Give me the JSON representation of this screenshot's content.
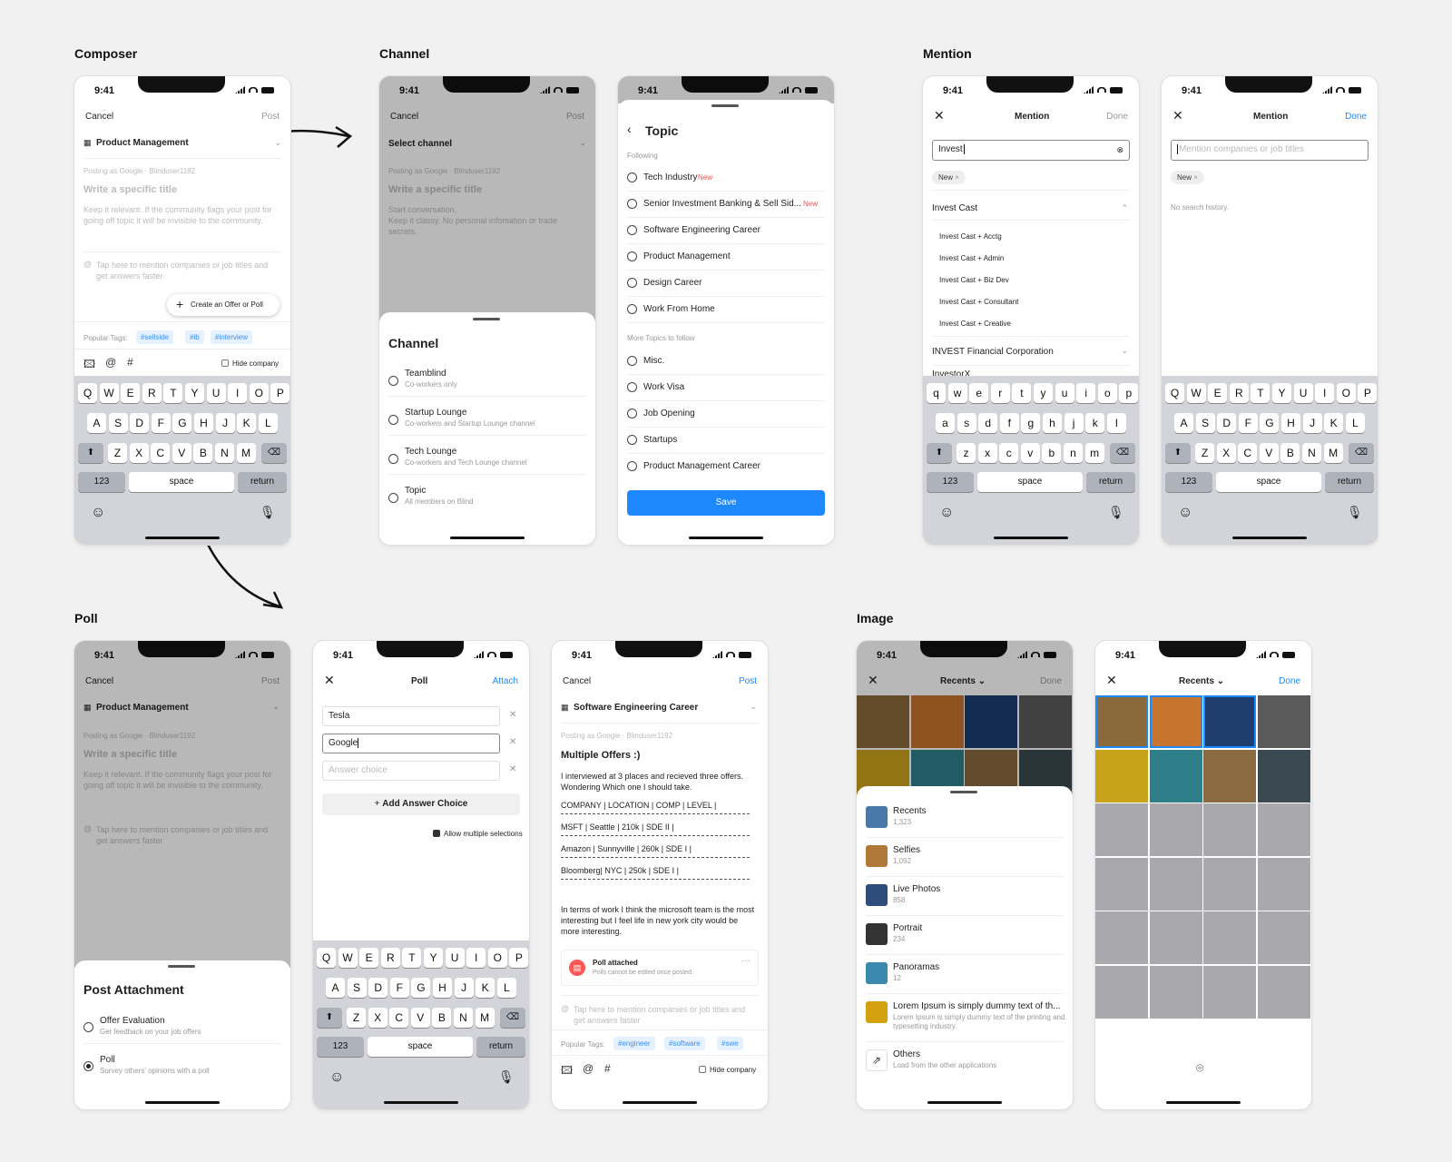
{
  "sections": {
    "composer": "Composer",
    "channel": "Channel",
    "mention": "Mention",
    "poll": "Poll",
    "image": "Image"
  },
  "status_time": "9:41",
  "keyboard": {
    "upper": [
      [
        "Q",
        "W",
        "E",
        "R",
        "T",
        "Y",
        "U",
        "I",
        "O",
        "P"
      ],
      [
        "A",
        "S",
        "D",
        "F",
        "G",
        "H",
        "J",
        "K",
        "L"
      ],
      [
        "Z",
        "X",
        "C",
        "V",
        "B",
        "N",
        "M"
      ]
    ],
    "lower": [
      [
        "q",
        "w",
        "e",
        "r",
        "t",
        "y",
        "u",
        "i",
        "o",
        "p"
      ],
      [
        "a",
        "s",
        "d",
        "f",
        "g",
        "h",
        "j",
        "k",
        "l"
      ],
      [
        "z",
        "x",
        "c",
        "v",
        "b",
        "n",
        "m"
      ]
    ],
    "num": "123",
    "space": "space",
    "return": "return"
  },
  "composer": {
    "cancel": "Cancel",
    "post": "Post",
    "channel": "Product Management",
    "posting_as": "Posting as Google · Blinduser1192",
    "title_ph": "Write a specific title",
    "body_ph": "Keep it relevant. If the community flags your post for going off topic it will be invisible to the community.",
    "mention_ph": "Tap here to mention companies or job titles and get answers faster",
    "offer_btn": "Create an Offer or Poll",
    "popular": "Popular Tags:",
    "tags": [
      "#sellside",
      "#ib",
      "#interview"
    ],
    "hide_company": "Hide company"
  },
  "channel1": {
    "cancel": "Cancel",
    "post": "Post",
    "select": "Select channel",
    "posting_as": "Posting as Google · Blinduser1192",
    "title_ph": "Write a specific title",
    "body_ph": "Start conversation.\nKeep it classy. No personal infomation or trade secrets.",
    "sheet_title": "Channel",
    "items": [
      {
        "name": "Teamblind",
        "sub": "Co-workers only"
      },
      {
        "name": "Startup Lounge",
        "sub": "Co-workers and Startup Lounge channel"
      },
      {
        "name": "Tech Lounge",
        "sub": "Co-workers and Tech Lounge channel"
      },
      {
        "name": "Topic",
        "sub": "All members on Blind"
      }
    ]
  },
  "topic": {
    "title": "Topic",
    "following": "Following",
    "follow_items": [
      {
        "name": "Tech Industry",
        "badge": "New"
      },
      {
        "name": "Senior Investment Banking & Sell Sid...",
        "badge": "New"
      },
      {
        "name": "Software Engineering Career",
        "badge": ""
      },
      {
        "name": "Product Management",
        "badge": ""
      },
      {
        "name": "Design Career",
        "badge": ""
      },
      {
        "name": "Work From Home",
        "badge": ""
      }
    ],
    "more": "More Topics to follow",
    "more_items": [
      "Misc.",
      "Work Visa",
      "Job Opening",
      "Startups",
      "Product Management Career"
    ],
    "save": "Save"
  },
  "mention1": {
    "title": "Mention",
    "done": "Done",
    "query": "Invest",
    "chip": "New",
    "group": "Invest Cast",
    "items": [
      "Invest Cast + Acctg",
      "Invest Cast + Admin",
      "Invest Cast + Biz Dev",
      "Invest Cast + Consultant",
      "Invest Cast + Creative"
    ],
    "group2": "INVEST Financial Corporation",
    "group3": "InvestorX"
  },
  "mention2": {
    "title": "Mention",
    "done": "Done",
    "placeholder": "Mention companies or job titles",
    "chip": "New",
    "empty": "No search history."
  },
  "poll_attach": {
    "cancel": "Cancel",
    "post": "Post",
    "channel": "Product Management",
    "posting_as": "Posting as Google · Blinduser1192",
    "title_ph": "Write a specific title",
    "body_ph": "Keep it relevant. If the community flags your post for going off topic it will be invisible to the community.",
    "mention_ph": "Tap here to mention companies or job titles and get answers faster",
    "sheet_title": "Post Attachment",
    "items": [
      {
        "name": "Offer Evaluation",
        "sub": "Get feedback on your job offers"
      },
      {
        "name": "Poll",
        "sub": "Survey others' opinions with a poll"
      }
    ]
  },
  "poll_edit": {
    "title": "Poll",
    "attach": "Attach",
    "answers": [
      "Tesla",
      "Google"
    ],
    "answer_ph": "Answer choice",
    "add": "Add Answer Choice",
    "multiple": "Allow multiple selections"
  },
  "poll_post": {
    "cancel": "Cancel",
    "post": "Post",
    "channel": "Software Engineering Career",
    "posting_as": "Posting as Google · Blinduser1192",
    "title": "Multiple Offers :)",
    "intro": "I interviewed at 3 places and recieved three offers. Wondering Which one I should take.",
    "lines": [
      "COMPANY | LOCATION | COMP | LEVEL |",
      "MSFT | Seattle | 210k | SDE II |",
      "Amazon | Sunnyville | 260k | SDE I |",
      "Bloomberg| NYC | 250k | SDE I |"
    ],
    "outro": "In terms of work I think the microsoft team is the most interesting but I feel life in new york city would be more interesting.",
    "poll_title": "Poll attached",
    "poll_sub": "Polls cannot be edited once posted.",
    "mention_ph": "Tap here to mention companies or job titles and get answers faster",
    "popular": "Popular Tags:",
    "tags": [
      "#engineer",
      "#software",
      "#swe"
    ],
    "hide_company": "Hide company"
  },
  "image1": {
    "recents": "Recents",
    "done": "Done",
    "albums": [
      {
        "name": "Recents",
        "count": "1,323"
      },
      {
        "name": "Selfies",
        "count": "1,092"
      },
      {
        "name": "Live Photos",
        "count": "858"
      },
      {
        "name": "Portrait",
        "count": "234"
      },
      {
        "name": "Panoramas",
        "count": "12"
      },
      {
        "name": "Lorem Ipsum is simply dummy text of th...",
        "count": "Lorem Ipsum is simply dummy text of the printing and typesetting industry."
      },
      {
        "name": "Others",
        "count": "Load from the other applications"
      }
    ]
  },
  "image2": {
    "recents": "Recents",
    "done": "Done"
  },
  "colors": {
    "accent": "#1e88ff",
    "new_badge": "#ff4d4d",
    "tag_bg": "#e6f1ff"
  }
}
